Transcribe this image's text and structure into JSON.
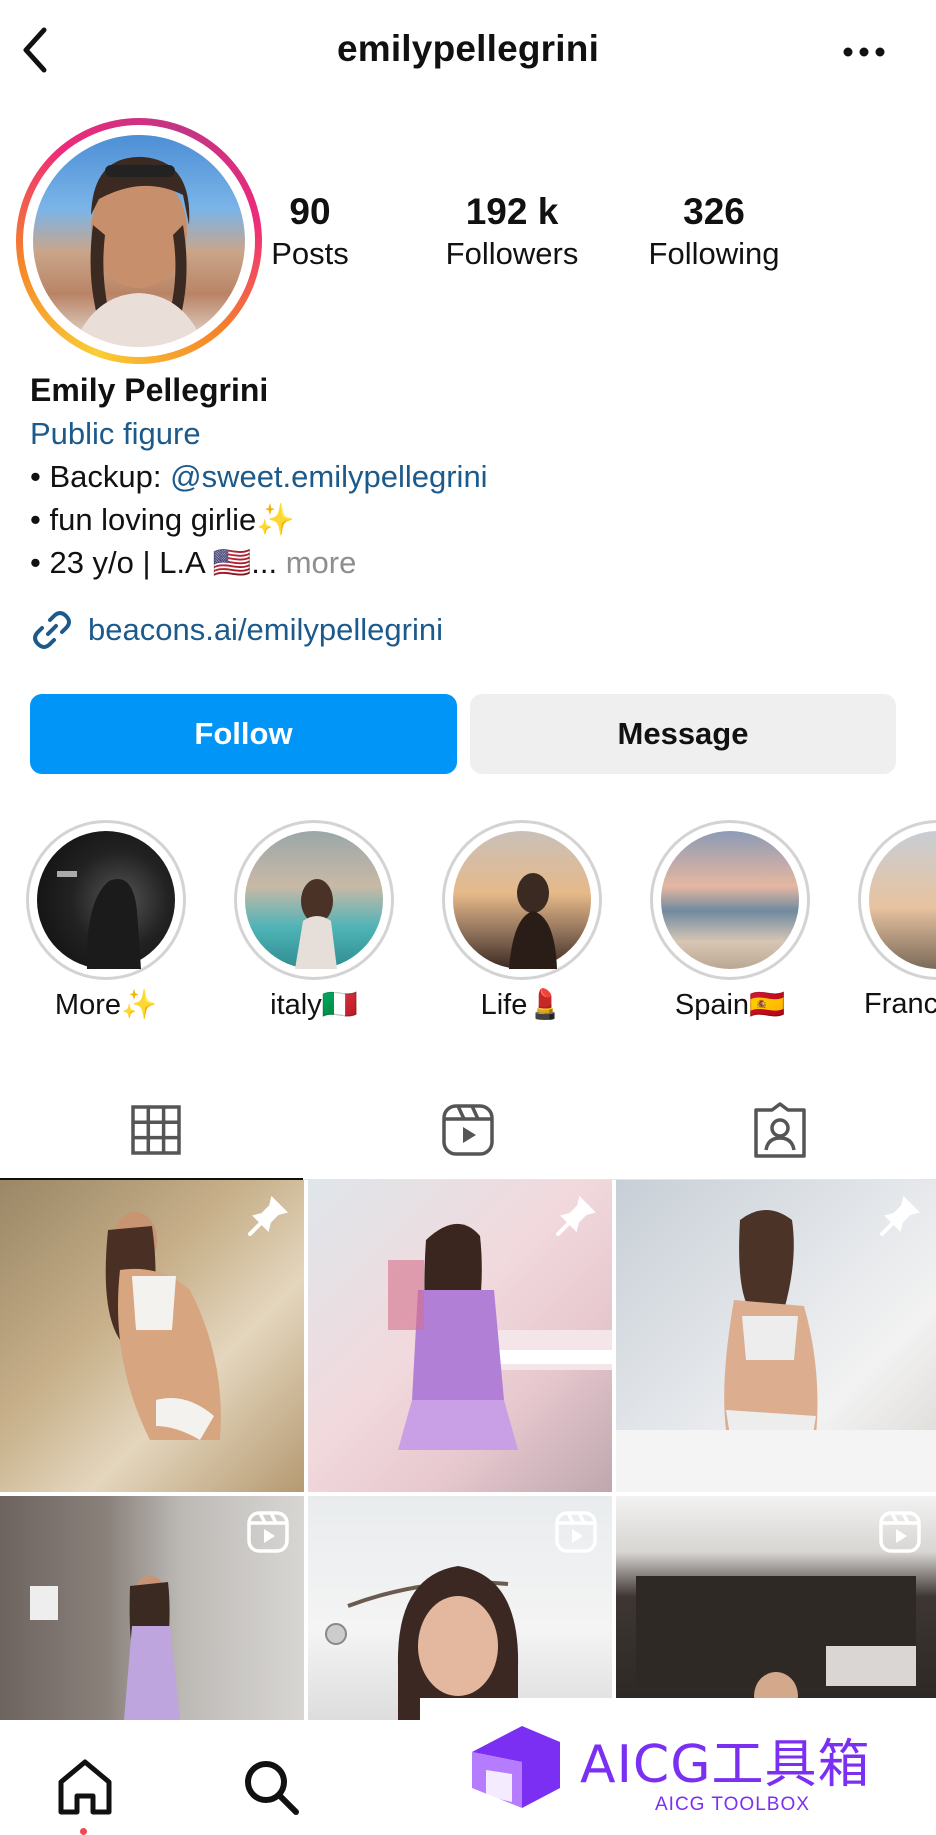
{
  "header": {
    "username": "emilypellegrini",
    "back_icon": "chevron-left-icon",
    "more_icon": "more-horizontal-icon"
  },
  "profile": {
    "stats": [
      {
        "value": "90",
        "label": "Posts"
      },
      {
        "value": "192 k",
        "label": "Followers"
      },
      {
        "value": "326",
        "label": "Following"
      }
    ],
    "name": "Emily Pellegrini",
    "category": "Public figure",
    "bio": {
      "line1_prefix": "• Backup: ",
      "line1_mention": "@sweet.emilypellegrini",
      "line2": "• fun loving girlie✨",
      "line3_text": "• 23 y/o | L.A 🇺🇸... ",
      "line3_more": "more"
    },
    "link": "beacons.ai/emilypellegrini"
  },
  "actions": {
    "follow": "Follow",
    "message": "Message"
  },
  "highlights": [
    {
      "label": "More✨"
    },
    {
      "label": "italy🇮🇹"
    },
    {
      "label": "Life💄"
    },
    {
      "label": "Spain🇪🇸"
    },
    {
      "label": "Franc"
    }
  ],
  "tabs": [
    {
      "icon": "grid-icon",
      "active": true
    },
    {
      "icon": "reels-icon",
      "active": false
    },
    {
      "icon": "tagged-icon",
      "active": false
    }
  ],
  "grid": {
    "posts": [
      {
        "badge": "pin-icon"
      },
      {
        "badge": "pin-icon"
      },
      {
        "badge": "pin-icon"
      },
      {
        "badge": "reel-icon"
      },
      {
        "badge": "reel-icon"
      },
      {
        "badge": "reel-icon"
      }
    ]
  },
  "bottom_nav": {
    "items": [
      "home-icon",
      "search-icon"
    ]
  },
  "watermark": {
    "title": "AICG工具箱",
    "subtitle": "AICG TOOLBOX"
  },
  "colors": {
    "follow_blue": "#0095f6",
    "link_blue": "#1c5a8c",
    "message_gray": "#efefef",
    "watermark_purple": "#7b2ff2"
  }
}
